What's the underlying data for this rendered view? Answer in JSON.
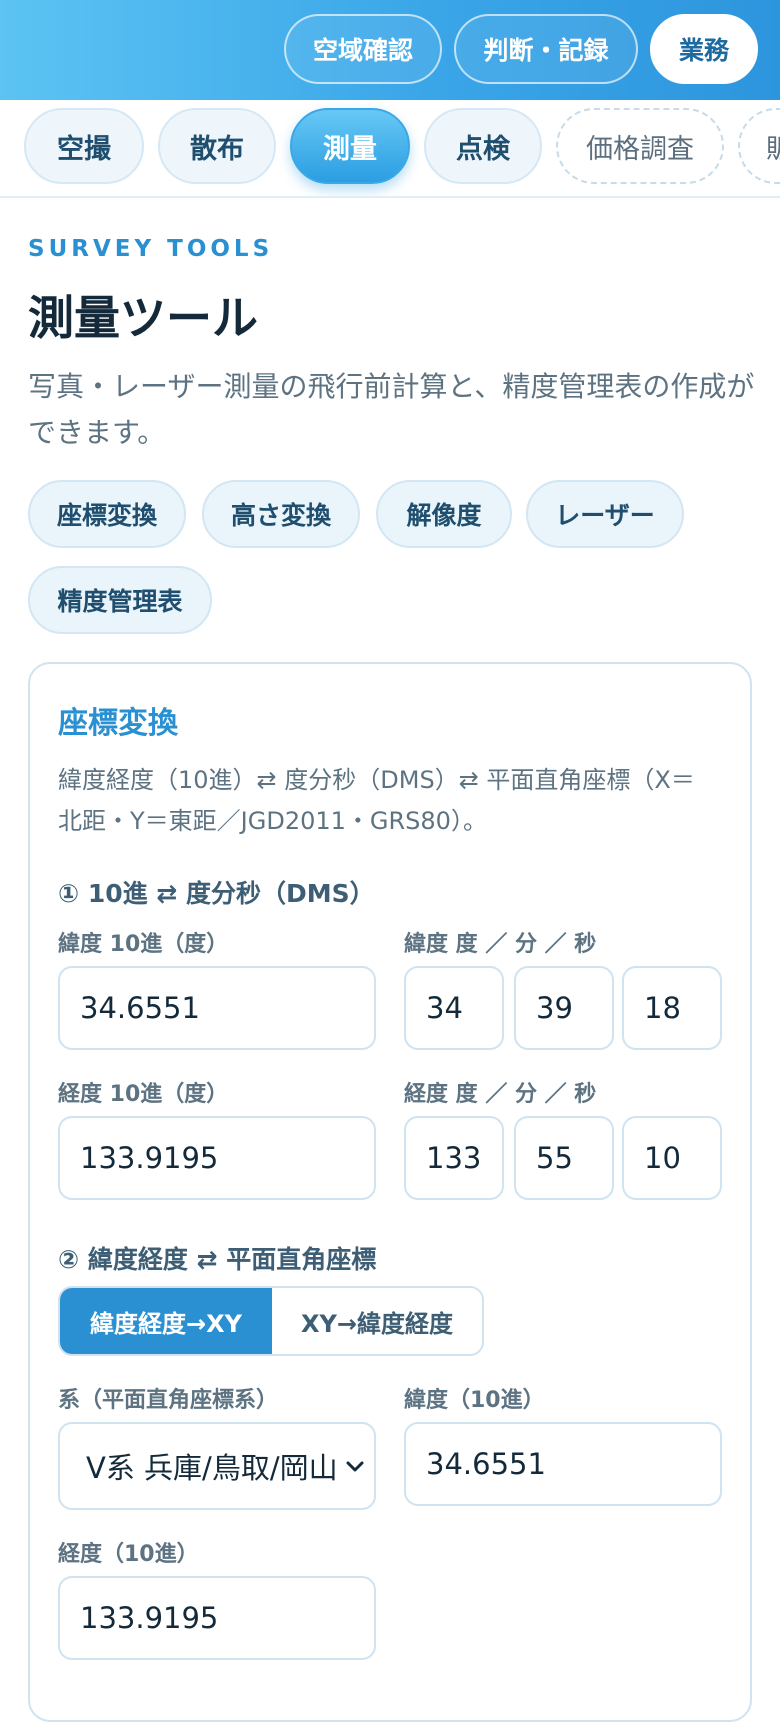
{
  "header": {
    "buttons": [
      {
        "label": "空域確認",
        "active": false
      },
      {
        "label": "判断・記録",
        "active": false
      },
      {
        "label": "業務",
        "active": true
      }
    ]
  },
  "tabs": [
    {
      "label": "空撮",
      "state": "normal"
    },
    {
      "label": "散布",
      "state": "normal"
    },
    {
      "label": "測量",
      "state": "active"
    },
    {
      "label": "点検",
      "state": "normal"
    },
    {
      "label": "価格調査",
      "state": "dashed"
    },
    {
      "label": "販",
      "state": "dashed"
    }
  ],
  "intro": {
    "eyebrow": "SURVEY TOOLS",
    "title": "測量ツール",
    "description": "写真・レーザー測量の飛行前計算と、精度管理表の作成ができます。"
  },
  "chips": [
    "座標変換",
    "高さ変換",
    "解像度",
    "レーザー",
    "精度管理表"
  ],
  "card": {
    "title": "座標変換",
    "description": "緯度経度（10進）⇄ 度分秒（DMS）⇄ 平面直角座標（X＝北距・Y＝東距／JGD2011・GRS80）。",
    "section1": {
      "heading": "① 10進 ⇄ 度分秒（DMS）",
      "lat_decimal_label": "緯度 10進（度）",
      "lat_decimal_value": "34.6551",
      "lat_dms_label": "緯度 度 ／ 分 ／ 秒",
      "lat_dms": [
        "34",
        "39",
        "18"
      ],
      "lon_decimal_label": "経度 10進（度）",
      "lon_decimal_value": "133.9195",
      "lon_dms_label": "経度 度 ／ 分 ／ 秒",
      "lon_dms": [
        "133",
        "55",
        "10"
      ]
    },
    "section2": {
      "heading": "② 緯度経度 ⇄ 平面直角座標",
      "mode_options": [
        "緯度経度→XY",
        "XY→緯度経度"
      ],
      "mode_selected": "緯度経度→XY",
      "system_label": "系（平面直角座標系）",
      "system_value": "V系 兵庫/鳥取/岡山",
      "lat_label": "緯度（10進）",
      "lat_value": "34.6551",
      "lon_label": "経度（10進）",
      "lon_value": "133.9195"
    }
  },
  "colors": {
    "accent": "#2a90d2",
    "header_gradient_start": "#5cc3f3",
    "header_gradient_end": "#2d95dd",
    "text_dark": "#142a3a",
    "text_muted": "#5d7382"
  }
}
